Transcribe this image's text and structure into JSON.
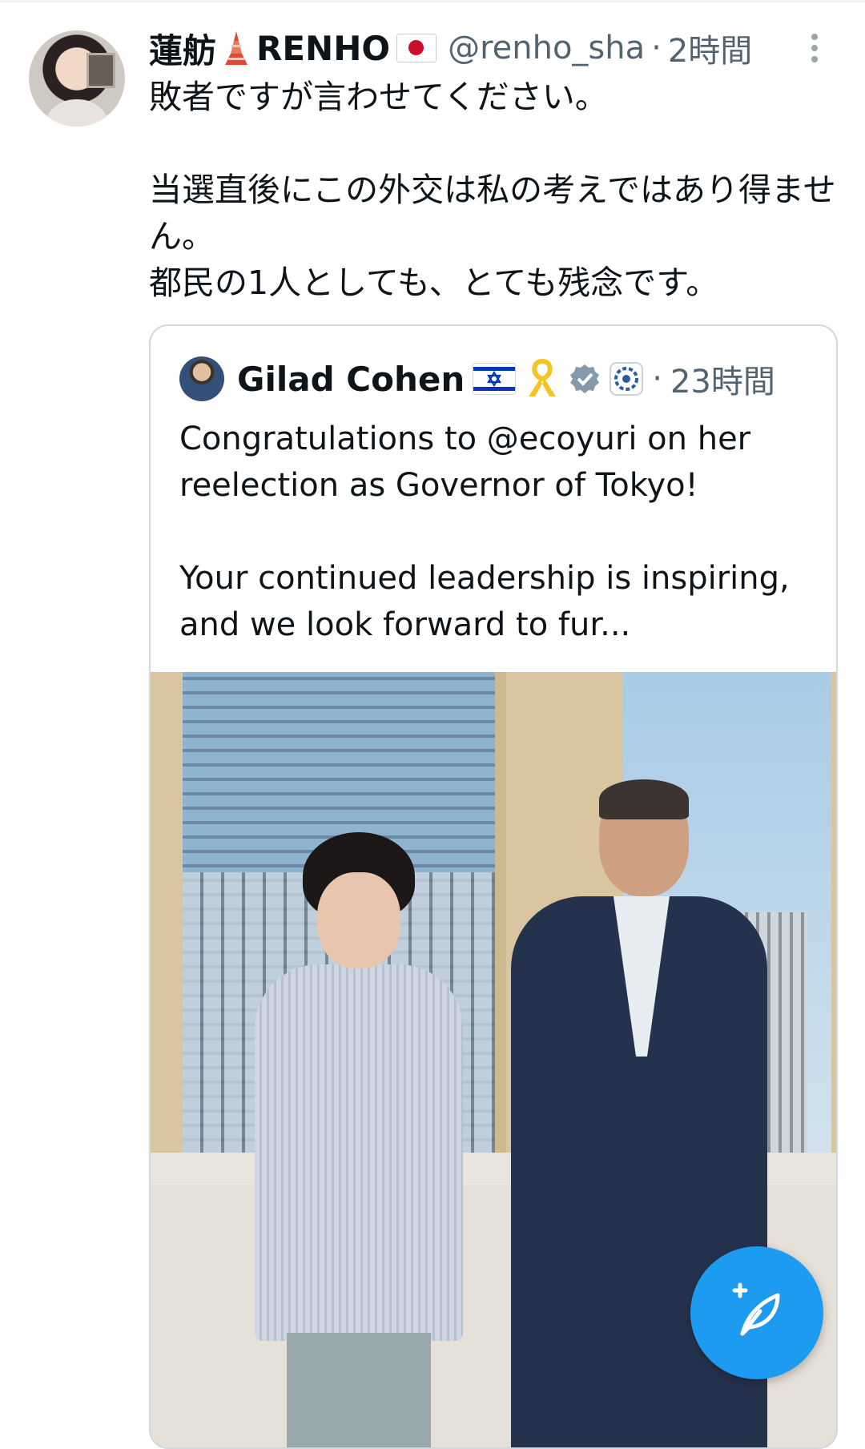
{
  "tweet": {
    "author": {
      "display_name": "蓮舫",
      "display_name_suffix": "RENHO",
      "handle": "@renho_sha",
      "time": "2時間"
    },
    "separator": "·",
    "text": "敗者ですが言わせてください。\n\n当選直後にこの外交は私の考えではあり得ません。\n都民の1人としても、とても残念です。"
  },
  "quote": {
    "author": {
      "display_name": "Gilad Cohen",
      "time": "23時間"
    },
    "separator": "·",
    "text": "Congratulations to @ecoyuri on her reelection as Governor of Tokyo!\n\nYour continued leadership is inspiring, and we look forward to fur..."
  },
  "icons": {
    "tower": "tokyo-tower-icon",
    "flag_jp": "japan-flag-icon",
    "flag_il": "israel-flag-icon",
    "ribbon": "yellow-ribbon-icon",
    "verified": "verified-badge-icon",
    "org": "organization-badge-icon",
    "more": "more-options-icon",
    "compose": "compose-post-icon"
  },
  "colors": {
    "accent": "#1d9bf0",
    "secondary_text": "#536471",
    "border": "#cfd9de"
  }
}
